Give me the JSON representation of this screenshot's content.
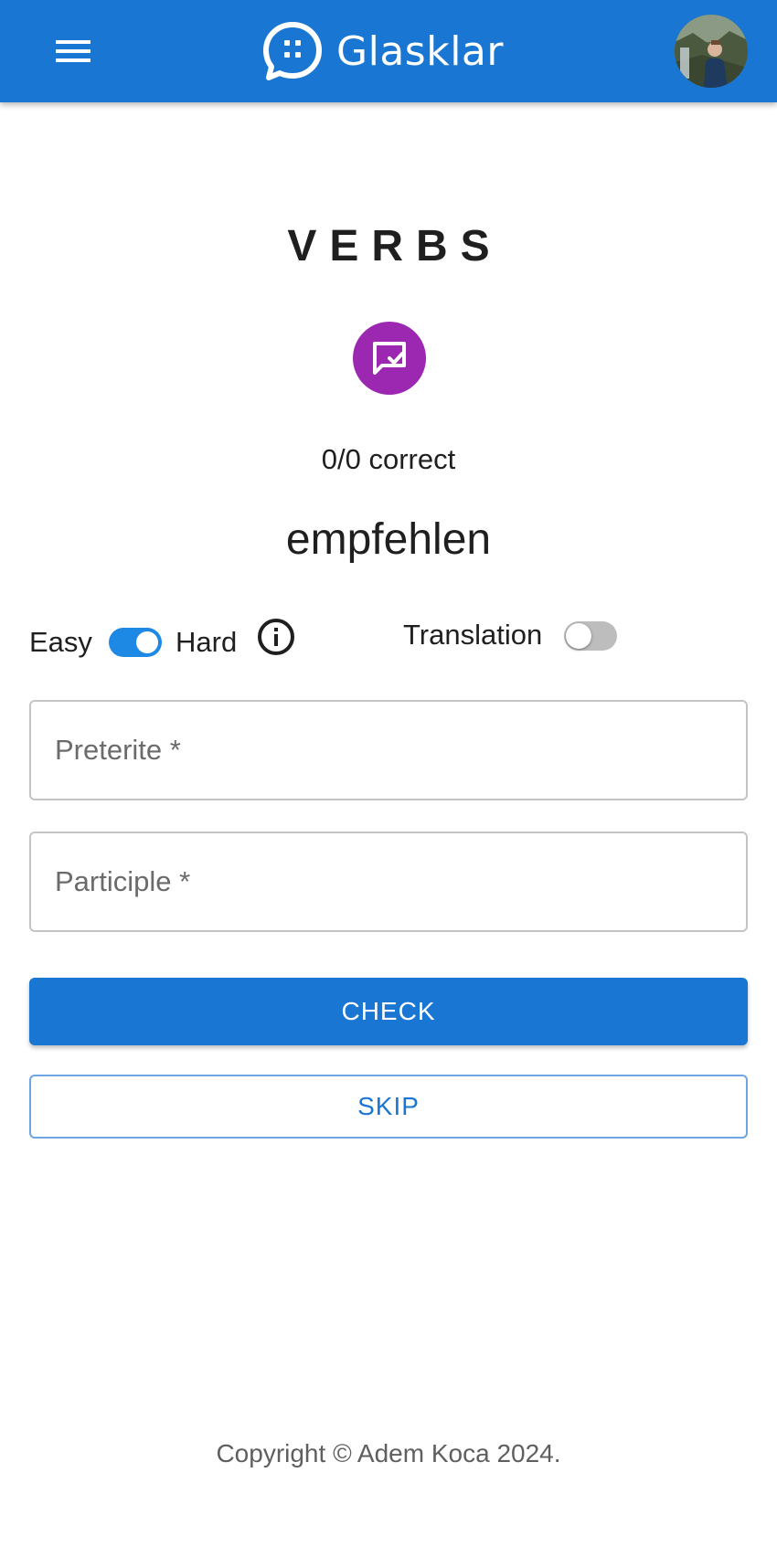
{
  "appbar": {
    "brand": "Glasklar",
    "menu_icon": "menu-icon",
    "logo_icon": "chat-bubble-logo-icon",
    "avatar": "user-avatar-photo",
    "background_color": "#1976d2"
  },
  "main": {
    "title": "VERBS",
    "badge_icon": "message-check-icon",
    "badge_color": "#9c27b0",
    "score_text": "0/0 correct",
    "word": "empfehlen"
  },
  "options": {
    "easy_label": "Easy",
    "hard_label": "Hard",
    "difficulty_toggle_on": true,
    "info_icon": "info-icon",
    "translation_label": "Translation",
    "translation_toggle_on": false
  },
  "form": {
    "preterite_placeholder": "Preterite *",
    "preterite_value": "",
    "participle_placeholder": "Participle *",
    "participle_value": ""
  },
  "actions": {
    "check_label": "CHECK",
    "skip_label": "SKIP"
  },
  "footer": {
    "copyright": "Copyright © Adem Koca 2024."
  }
}
